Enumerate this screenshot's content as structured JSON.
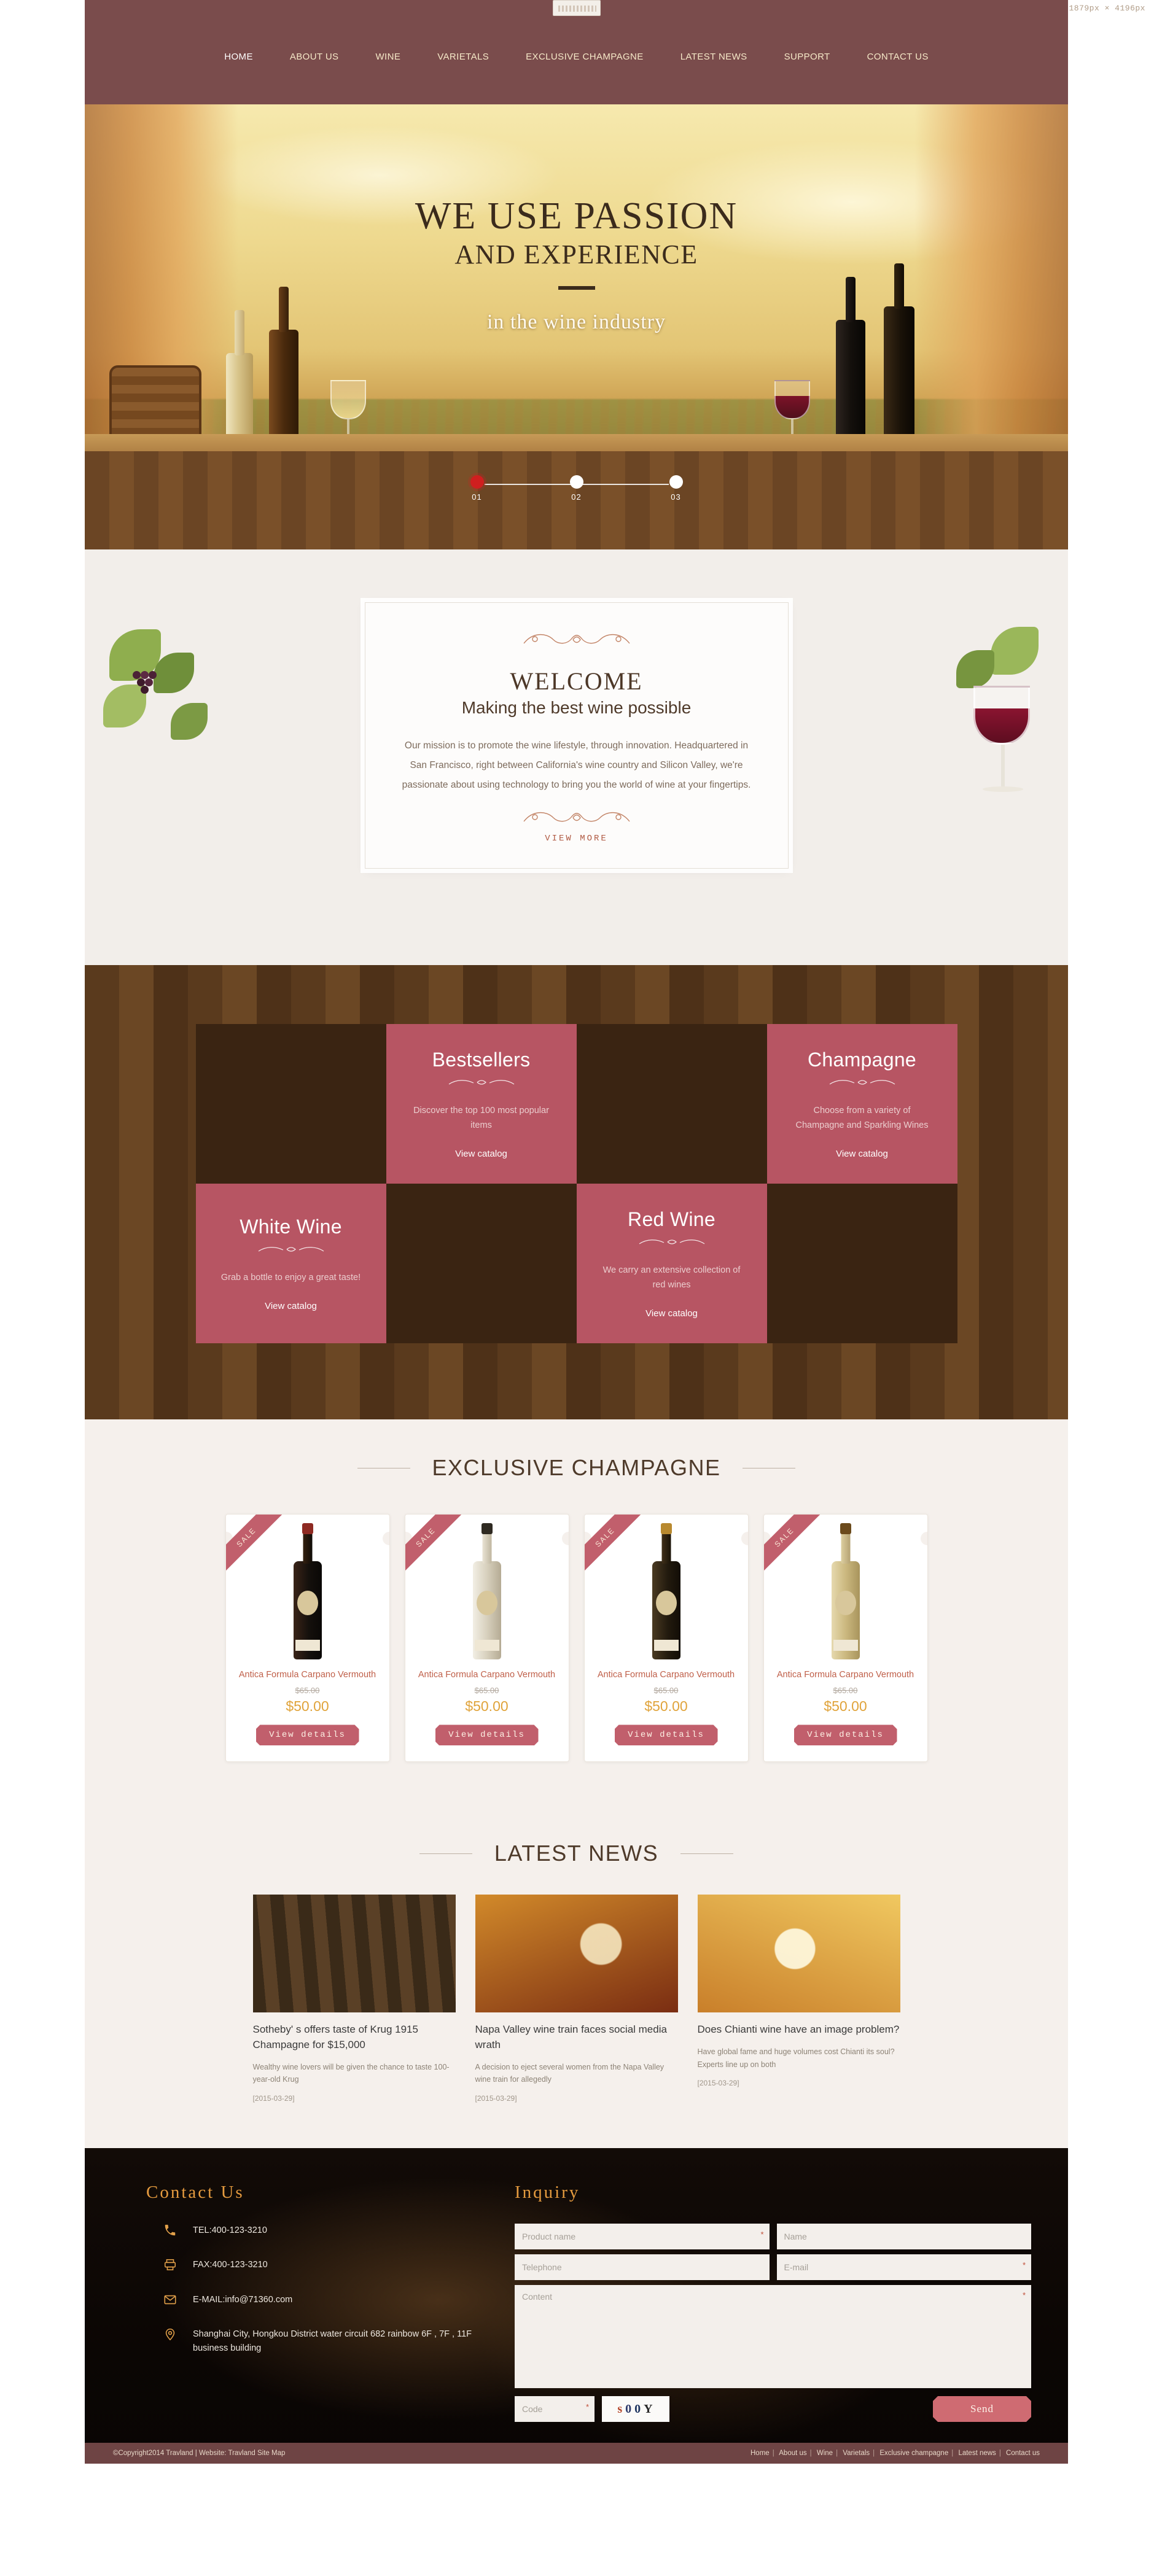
{
  "meta": {
    "dimensions_label": "1879px × 4196px"
  },
  "header": {
    "logo_alt": "wine-logo",
    "nav": [
      {
        "label": "HOME",
        "active": true
      },
      {
        "label": "ABOUT US",
        "active": false
      },
      {
        "label": "WINE",
        "active": false
      },
      {
        "label": "VARIETALS",
        "active": false
      },
      {
        "label": "EXCLUSIVE CHAMPAGNE",
        "active": false
      },
      {
        "label": "LATEST NEWS",
        "active": false
      },
      {
        "label": "SUPPORT",
        "active": false
      },
      {
        "label": "CONTACT US",
        "active": false
      }
    ]
  },
  "hero": {
    "line1": "WE USE PASSION",
    "line2": "AND EXPERIENCE",
    "line3": "in the wine industry",
    "slides": [
      {
        "number": "01",
        "active": true
      },
      {
        "number": "02",
        "active": false
      },
      {
        "number": "03",
        "active": false
      }
    ]
  },
  "welcome": {
    "heading": "WELCOME",
    "subheading": "Making the best wine possible",
    "paragraph": "Our mission is to promote the wine lifestyle, through innovation. Headquartered in San Francisco, right between California's wine country and Silicon Valley, we're passionate about using technology to bring you the world of wine at your fingertips.",
    "cta": "VIEW MORE"
  },
  "categories": {
    "accent_color": "#b75563",
    "tiles": [
      {
        "title": "Bestsellers",
        "desc": "Discover the top 100 most popular items",
        "link": "View catalog"
      },
      {
        "title": "Champagne",
        "desc": "Choose from a variety of Champagne and Sparkling Wines",
        "link": "View catalog"
      },
      {
        "title": "White Wine",
        "desc": "Grab a bottle to enjoy a great taste!",
        "link": "View catalog"
      },
      {
        "title": "Red Wine",
        "desc": "We carry an extensive collection of red wines",
        "link": "View catalog"
      }
    ]
  },
  "exclusive": {
    "title": "EXCLUSIVE CHAMPAGNE",
    "products": [
      {
        "badge": "SALE",
        "name": "Antica Formula Carpano Vermouth",
        "old_price": "$65.00",
        "price": "$50.00",
        "button": "View details"
      },
      {
        "badge": "SALE",
        "name": "Antica Formula Carpano Vermouth",
        "old_price": "$65.00",
        "price": "$50.00",
        "button": "View details"
      },
      {
        "badge": "SALE",
        "name": "Antica Formula Carpano Vermouth",
        "old_price": "$65.00",
        "price": "$50.00",
        "button": "View details"
      },
      {
        "badge": "SALE",
        "name": "Antica Formula Carpano Vermouth",
        "old_price": "$65.00",
        "price": "$50.00",
        "button": "View details"
      }
    ]
  },
  "news": {
    "title": "LATEST NEWS",
    "items": [
      {
        "title": "Sotheby' s offers taste of Krug 1915 Champagne for $15,000",
        "excerpt": "Wealthy wine lovers will be given the chance to taste 100-year-old Krug",
        "date": "[2015-03-29]"
      },
      {
        "title": "Napa Valley wine train faces social media wrath",
        "excerpt": "A decision to eject several women from the Napa Valley wine train for allegedly",
        "date": "[2015-03-29]"
      },
      {
        "title": "Does Chianti wine have an image problem?",
        "excerpt": "Have global fame and huge volumes cost Chianti its soul? Experts line up on both",
        "date": "[2015-03-29]"
      }
    ]
  },
  "contact": {
    "title": "Contact Us",
    "lines": [
      {
        "icon": "phone-icon",
        "text": "TEL:400-123-3210"
      },
      {
        "icon": "fax-icon",
        "text": "FAX:400-123-3210"
      },
      {
        "icon": "mail-icon",
        "text": "E-MAIL:info@71360.com"
      },
      {
        "icon": "location-icon",
        "text": "Shanghai City, Hongkou District water circuit 682 rainbow 6F , 7F , 11F business building"
      }
    ]
  },
  "inquiry": {
    "title": "Inquiry",
    "fields": {
      "product_name": {
        "placeholder": "Product name",
        "value": "",
        "required": "*"
      },
      "name": {
        "placeholder": "Name",
        "value": "",
        "required": ""
      },
      "telephone": {
        "placeholder": "Telephone",
        "value": "",
        "required": ""
      },
      "email": {
        "placeholder": "E-mail",
        "value": "",
        "required": "*"
      },
      "content": {
        "placeholder": "Content",
        "value": "",
        "required": "*"
      },
      "code": {
        "placeholder": "Code",
        "value": "",
        "required": "*"
      }
    },
    "captcha": {
      "c1": "s",
      "c2": "0",
      "c3": "0",
      "c4": "Y"
    },
    "send_label": "Send"
  },
  "footer_bar": {
    "copyright": "©Copyright2014 Travland | Website: Travland  Site Map",
    "links": [
      "Home",
      "About us",
      "Wine",
      "Varietals",
      "Exclusive champagne",
      "Latest news",
      "Contact us"
    ]
  }
}
